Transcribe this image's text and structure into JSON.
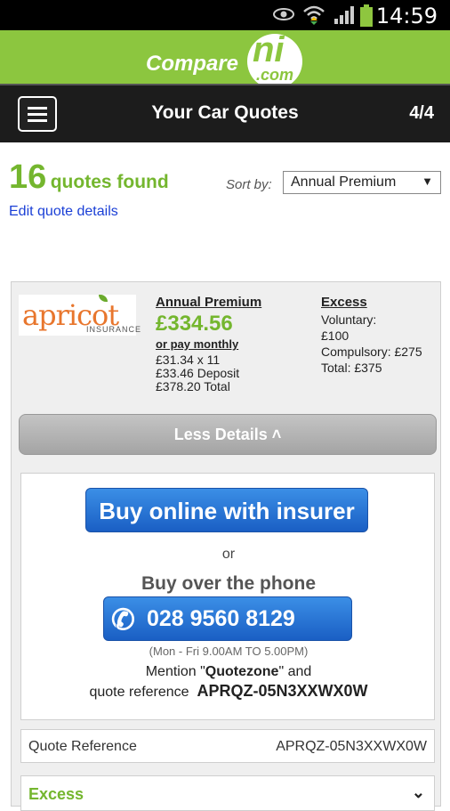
{
  "status_bar": {
    "time": "14:59"
  },
  "brand": {
    "compare": "Compare",
    "ni": "ni",
    "com": ".com"
  },
  "header": {
    "title": "Your Car Quotes",
    "step": "4/4"
  },
  "results": {
    "count": "16",
    "count_label": "quotes found",
    "edit_link": "Edit quote details"
  },
  "sort": {
    "label": "Sort by:",
    "selected": "Annual Premium"
  },
  "quote": {
    "insurer": "apricot",
    "insurer_sub": "INSURANCE",
    "annual_premium_label": "Annual Premium",
    "annual_premium": "£334.56",
    "monthly_label": "or pay monthly",
    "monthly_lines": [
      "£31.34 x 11",
      "£33.46 Deposit",
      "£378.20 Total"
    ],
    "excess_label": "Excess",
    "excess_lines": [
      "Voluntary:",
      "£100",
      "Compulsory: £275",
      "Total: £375"
    ],
    "less_details": "Less Details ˄",
    "buy_online": "Buy online with insurer",
    "or": "or",
    "buy_phone": "Buy over the phone",
    "phone_number": "028 9560 8129",
    "hours": "(Mon - Fri 9.00AM TO 5.00PM)",
    "mention_prefix": "Mention \"",
    "mention_name": "Quotezone",
    "mention_suffix": "\" and",
    "ref_prefix": "quote reference",
    "ref_code": "APRQZ-05N3XXWX0W",
    "quote_reference_label": "Quote Reference",
    "quote_reference_value": "APRQZ-05N3XXWX0W",
    "excess_section": "Excess"
  }
}
